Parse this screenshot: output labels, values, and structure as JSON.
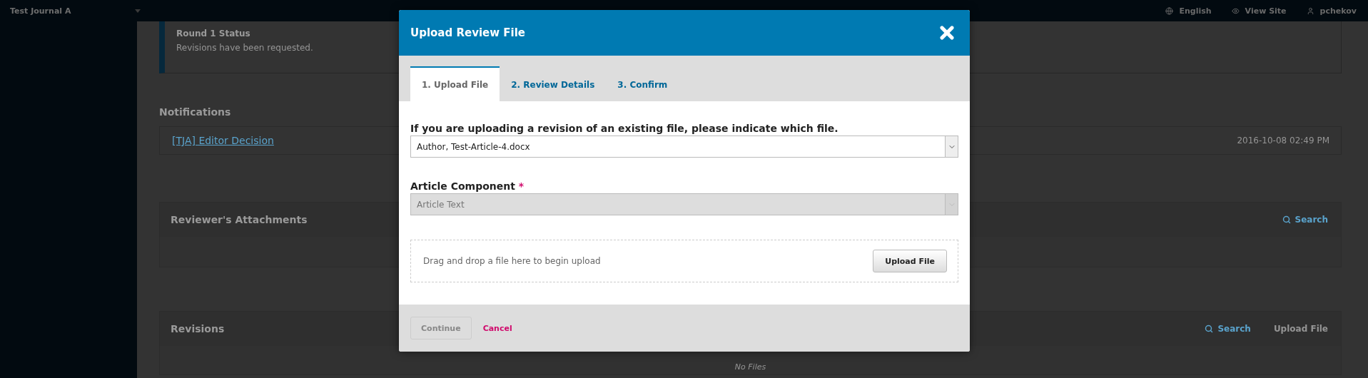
{
  "top_bar": {
    "journal": "Test Journal A",
    "links": [
      {
        "label": "English"
      },
      {
        "label": "View Site"
      },
      {
        "label": "pchekov"
      }
    ]
  },
  "status_box": {
    "title": "Round 1 Status",
    "text": "Revisions have been requested."
  },
  "notifications": {
    "heading": "Notifications",
    "items": [
      {
        "title": "[TJA] Editor Decision",
        "date": "2016-10-08 02:49 PM"
      }
    ]
  },
  "panels": [
    {
      "title": "Reviewer's Attachments",
      "actions": [
        {
          "kind": "search",
          "label": "Search"
        }
      ]
    },
    {
      "title": "Revisions",
      "actions": [
        {
          "kind": "search",
          "label": "Search"
        },
        {
          "kind": "plain",
          "label": "Upload File"
        }
      ],
      "empty_text": "No Files"
    }
  ],
  "modal": {
    "title": "Upload Review File",
    "tabs": [
      {
        "label": "1. Upload File",
        "selected": true
      },
      {
        "label": "2. Review Details",
        "selected": false
      },
      {
        "label": "3. Confirm",
        "selected": false
      }
    ],
    "fields": [
      {
        "label": "If you are uploading a revision of an existing file, please indicate which file.",
        "value": "Author, Test-Article-4.docx",
        "disabled": false
      },
      {
        "label": "Article Component",
        "required_mark": "*",
        "value": "Article Text",
        "disabled": true
      }
    ],
    "dropzone": {
      "text": "Drag and drop a file here to begin upload",
      "button": "Upload File"
    },
    "footer": {
      "continue": {
        "label": "Continue",
        "disabled": true
      },
      "cancel": "Cancel"
    }
  }
}
